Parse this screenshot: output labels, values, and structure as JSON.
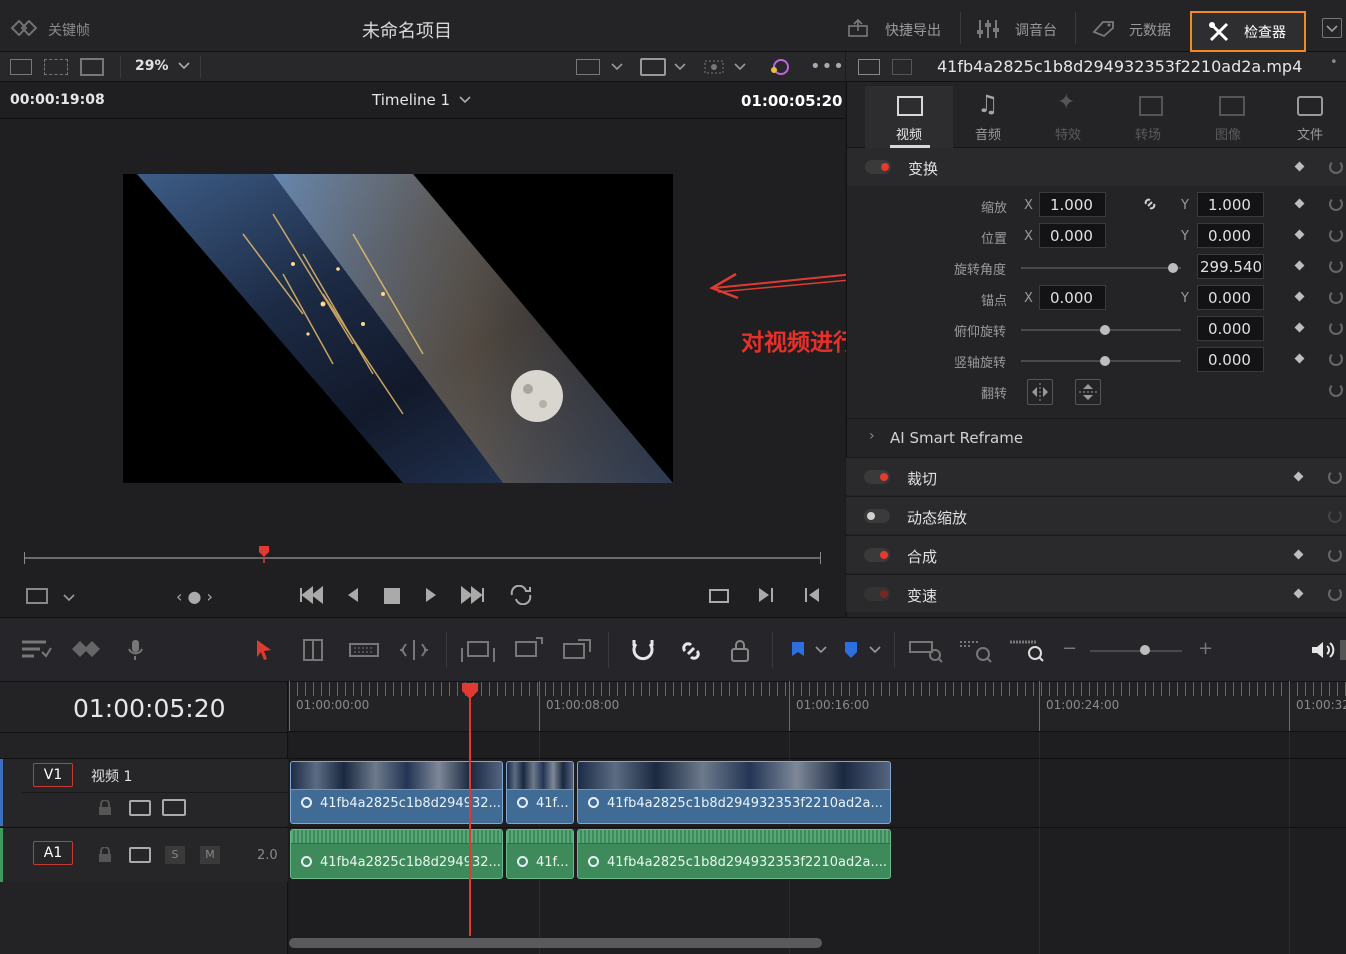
{
  "top": {
    "keyframes_label": "关键帧",
    "project_title": "未命名项目",
    "quick_export_label": "快捷导出",
    "mixer_label": "调音台",
    "metadata_label": "元数据",
    "inspector_label": "检查器"
  },
  "viewer": {
    "zoom": "29%",
    "source_timecode": "00:00:19:08",
    "timeline_name": "Timeline 1",
    "record_timecode": "01:00:05:20",
    "annotation": "对视频进行变换操作"
  },
  "inspector": {
    "clip_name": "41fb4a2825c1b8d294932353f2210ad2a.mp4",
    "tabs": [
      {
        "label": "视频",
        "active": true
      },
      {
        "label": "音频",
        "active": false
      },
      {
        "label": "特效",
        "active": false
      },
      {
        "label": "转场",
        "active": false
      },
      {
        "label": "图像",
        "active": false
      },
      {
        "label": "文件",
        "active": false
      }
    ],
    "transform": {
      "title": "变换",
      "zoom_label": "缩放",
      "zoom_x": "1.000",
      "zoom_y": "1.000",
      "position_label": "位置",
      "position_x": "0.000",
      "position_y": "0.000",
      "rotation_label": "旋转角度",
      "rotation": "299.540",
      "rotation_fraction": 0.84,
      "anchor_label": "锚点",
      "anchor_x": "0.000",
      "anchor_y": "0.000",
      "pitch_label": "俯仰旋转",
      "pitch": "0.000",
      "yaw_label": "竖轴旋转",
      "yaw": "0.000",
      "flip_label": "翻转",
      "x": "X",
      "y": "Y"
    },
    "ai_reframe": "AI Smart Reframe",
    "sections": [
      "裁切",
      "动态缩放",
      "合成",
      "变速"
    ]
  },
  "timeline": {
    "current_timecode": "01:00:05:20",
    "ruler": [
      "01:00:00:00",
      "01:00:08:00",
      "01:00:16:00",
      "01:00:24:00",
      "01:00:32"
    ],
    "v1": {
      "badge": "V1",
      "name": "视频 1"
    },
    "a1": {
      "badge": "A1",
      "level": "2.0",
      "solo": "S",
      "mute": "M"
    },
    "clips": [
      "41fb4a2825c1b8d294932...",
      "41f...",
      "41fb4a2825c1b8d294932353f2210ad2a..."
    ],
    "audio_clips": [
      "41fb4a2825c1b8d294932...",
      "41f...",
      "41fb4a2825c1b8d294932353f2210ad2a...."
    ]
  },
  "colors": {
    "accent_orange": "#f08a24",
    "playhead_red": "#e03a32",
    "video_clip": "#3f6b95",
    "audio_clip": "#3e8a5b"
  }
}
